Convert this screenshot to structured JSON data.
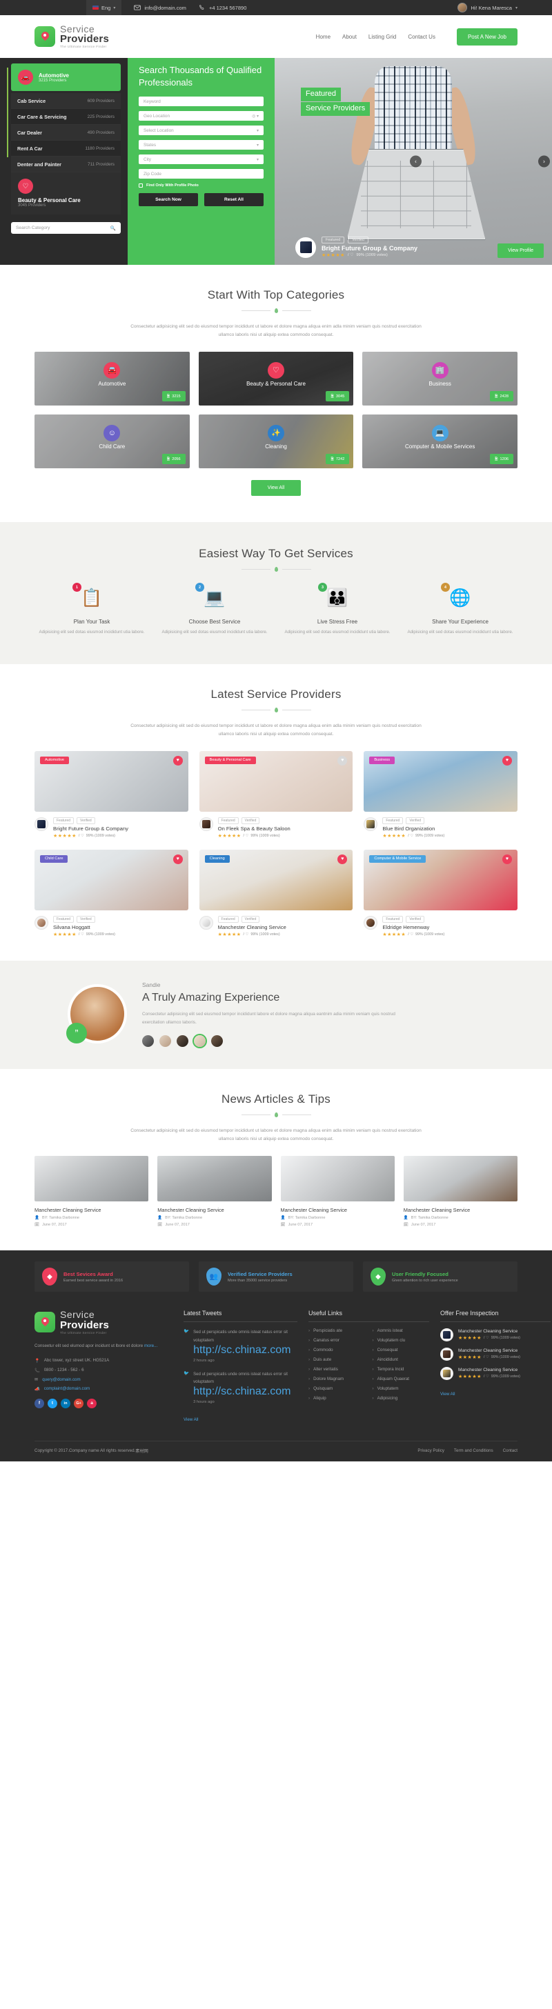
{
  "topbar": {
    "lang": "Eng",
    "email": "info@domain.com",
    "phone": "+4 1234 567890",
    "user_greeting": "Hi! Kena Maresca"
  },
  "header": {
    "logo_line1": "Service",
    "logo_line2": "Providers",
    "logo_tagline": "The Ultimate Service Finder",
    "nav": [
      "Home",
      "About",
      "Listing Grid",
      "Contact Us"
    ],
    "cta": "Post A New Job"
  },
  "hero": {
    "search_title": "Search Thousands of Qualified Professionals",
    "fields": [
      {
        "placeholder": "Keyword",
        "icon": ""
      },
      {
        "placeholder": "Geo Location",
        "icon": "target"
      },
      {
        "placeholder": "Select Location",
        "icon": "caret"
      },
      {
        "placeholder": "States",
        "icon": "caret"
      },
      {
        "placeholder": "City",
        "icon": "caret"
      },
      {
        "placeholder": "Zip Code",
        "icon": ""
      }
    ],
    "checkbox_label": "Find Only With Profile Photo",
    "search_button": "Search Now",
    "reset_button": "Reset All",
    "featured_line1": "Featured",
    "featured_line2": "Service Providers",
    "slide": {
      "badges": [
        "Featured",
        "Verified"
      ],
      "title": "Bright Future Group & Company",
      "rating_text": "99% (1009 votes)",
      "stars": "★★★★★",
      "button": "View Profile"
    },
    "categories_panel": {
      "active": {
        "name": "Automotive",
        "count": "3215 Providers",
        "icon": "car-icon"
      },
      "items": [
        {
          "name": "Cab Service",
          "count": "609 Providers"
        },
        {
          "name": "Car Care & Servicing",
          "count": "225 Providers"
        },
        {
          "name": "Car Dealer",
          "count": "490 Providers"
        },
        {
          "name": "Rent A Car",
          "count": "1180 Providers"
        },
        {
          "name": "Denter and Painter",
          "count": "711 Providers"
        }
      ],
      "next": {
        "name": "Beauty & Personal Care",
        "count": "3045 Providers",
        "icon": "heart-icon"
      },
      "search_placeholder": "Search Category"
    }
  },
  "categories_section": {
    "title": "Start With Top Categories",
    "subtitle": "Consectetur adipisicing elit sed do eiusmod tempor incididunt ut labore et dolore magna aliqua enim adla minim veniam quis nostrud exercitation ullamco laboris nisi ut aliquip extea commodo consequat.",
    "cards": [
      {
        "name": "Automotive",
        "count": "3215",
        "color": "#ef3e5c",
        "icon": "car-icon"
      },
      {
        "name": "Beauty & Personal Care",
        "count": "3045",
        "color": "#ef3e5c",
        "icon": "heart-icon"
      },
      {
        "name": "Business",
        "count": "2428",
        "color": "#cf46b8",
        "icon": "building-icon"
      },
      {
        "name": "Child Care",
        "count": "2056",
        "color": "#6c63c7",
        "icon": "smiley-icon"
      },
      {
        "name": "Cleaning",
        "count": "7242",
        "color": "#2f7fc9",
        "icon": "wand-icon"
      },
      {
        "name": "Computer & Mobile Services",
        "count": "1206",
        "color": "#4aa3df",
        "icon": "laptop-icon"
      }
    ],
    "view_all": "View All"
  },
  "steps_section": {
    "title": "Easiest Way To Get Services",
    "steps": [
      {
        "num": "1",
        "num_color": "#e2294f",
        "title": "Plan Your Task",
        "desc": "Adipisicing elit sed dotas eiusmod incididunt utia labore.",
        "glyph": "📋"
      },
      {
        "num": "2",
        "num_color": "#3d9ad8",
        "title": "Choose Best Service",
        "desc": "Adipisicing elit sed dotas eiusmod incididunt utia labore.",
        "glyph": "💻"
      },
      {
        "num": "3",
        "num_color": "#43b55c",
        "title": "Live Stress Free",
        "desc": "Adipisicing elit sed dotas eiusmod incididunt utia labore.",
        "glyph": "👪"
      },
      {
        "num": "4",
        "num_color": "#cd9539",
        "title": "Share Your Experience",
        "desc": "Adipisicing elit sed dotas eiusmod incididunt utia labore.",
        "glyph": "🌐"
      }
    ]
  },
  "providers_section": {
    "title": "Latest Service Providers",
    "subtitle": "Consectetur adipisicing elit sed do eiusmod tempor incididunt ut labore et dolore magna aliqua enim adla minim veniam quis nostrud exercitation ullamco laboris nisi ut aliquip extea commodo consequat.",
    "badges": [
      "Featured",
      "Verified"
    ],
    "stars": "★★★★★",
    "rating_text": "99% (1009 votes)",
    "cards": [
      {
        "tag": "Automotive",
        "tag_color": "#ef3e5c",
        "heart_color": "#ef3e5c",
        "name": "Bright Future Group & Company"
      },
      {
        "tag": "Beauty & Personal Care",
        "tag_color": "#ef3e5c",
        "heart_color": "#cfcfcf",
        "name": "On Fleek Spa & Beauty Saloon"
      },
      {
        "tag": "Business",
        "tag_color": "#cf46b8",
        "heart_color": "#ef3e5c",
        "name": "Blue Bird Organization"
      },
      {
        "tag": "Child Care",
        "tag_color": "#6c63c7",
        "heart_color": "#ef3e5c",
        "name": "Silvana Hoggatt"
      },
      {
        "tag": "Cleaning",
        "tag_color": "#2f7fc9",
        "heart_color": "#ef3e5c",
        "name": "Manchester Cleaning Service"
      },
      {
        "tag": "Computer & Mobile Service",
        "tag_color": "#4aa3df",
        "heart_color": "#ef3e5c",
        "name": "Eldridge Hemenway"
      }
    ]
  },
  "testimonial": {
    "name": "Sandie",
    "heading": "A Truly Amazing Experience",
    "text": "Consectetur adipisicing elit sed eiusmod tempor incididunt labore et dolore magna aliqua eantnim adia minim veniam quis nostrud exercitation ullamco laboris.",
    "quote_glyph": "”"
  },
  "news_section": {
    "title": "News Articles & Tips",
    "subtitle": "Consectetur adipisicing elit sed do eiusmod tempor incididunt ut labore et dolore magna aliqua enim adla minim veniam quis nostrud exercitation ullamco laboris nisi ut aliquip extea commodo consequat.",
    "cards": [
      {
        "title": "Manchester Cleaning Service",
        "by": "BY: Tamika Darbonne",
        "date": "June 07, 2017"
      },
      {
        "title": "Manchester Cleaning Service",
        "by": "BY: Tamika Darbonne",
        "date": "June 07, 2017"
      },
      {
        "title": "Manchester Cleaning Service",
        "by": "BY: Tamika Darbonne",
        "date": "June 07, 2017"
      },
      {
        "title": "Manchester Cleaning Service",
        "by": "BY: Tamika Darbonne",
        "date": "June 07, 2017"
      }
    ]
  },
  "footer": {
    "awards": [
      {
        "title": "Best Sevices Award",
        "desc": "Earned best service award in 2016",
        "color": "#ef3e5c",
        "icon": "diamond-icon"
      },
      {
        "title": "Verified Service Providers",
        "desc": "More than 35000 service providers",
        "color": "#4aa3df",
        "icon": "users-icon"
      },
      {
        "title": "User Friendly Focused",
        "desc": "Given attention to rich user experience",
        "color": "#4ac159",
        "icon": "diamond-icon"
      }
    ],
    "about": {
      "logo_line1": "Service",
      "logo_line2": "Providers",
      "logo_tagline": "The Ultimate Service Finder",
      "text": "Conseetur elit sed elumod apor incidunt ut lbore et dolore",
      "more": "more...",
      "address": "Abc tower, xyz street UK. HG521A",
      "phone": "0800 - 1234 - 562 - 6",
      "email": "query@domain.com",
      "complaint": "complaint@domain.com",
      "socials": [
        {
          "name": "facebook-icon",
          "glyph": "f",
          "color": "#3b5998"
        },
        {
          "name": "twitter-icon",
          "glyph": "t",
          "color": "#1da1f2"
        },
        {
          "name": "linkedin-icon",
          "glyph": "in",
          "color": "#0077b5"
        },
        {
          "name": "google-plus-icon",
          "glyph": "G+",
          "color": "#db4437"
        },
        {
          "name": "rss-icon",
          "glyph": "a",
          "color": "#e2294f"
        }
      ]
    },
    "tweets": {
      "heading": "Latest Tweets",
      "items": [
        {
          "text": "Sed ut perspicatis unde omnis isteat natus error sit voluptatem",
          "link": "http://sc.chinaz.com",
          "ago": "2 hours ago"
        },
        {
          "text": "Sed ut perspicatis unde omnis isteat natus error sit voluptatem",
          "link": "http://sc.chinaz.com",
          "ago": "3 hours ago"
        }
      ],
      "view_all": "View All"
    },
    "useful_links": {
      "heading": "Useful Links",
      "items": [
        "Perspiciatis ate",
        "Aomnis isteat",
        "Canatus error",
        "Voluptatem clu",
        "Commodo",
        "Consequat",
        "Duis aute",
        "Aincididunt",
        "Alter veritatis",
        "Tempora Incid",
        "Dolore Magnam",
        "Aliquam Quaerat",
        "Quisquam",
        "Voluptatem",
        "Aliquip",
        "Adipisicing"
      ]
    },
    "offers": {
      "heading": "Offer Free Inspection",
      "items": [
        {
          "name": "Manchester Cleaning Service",
          "stars": "★★★★★",
          "rating": "99% (1009 votes)"
        },
        {
          "name": "Manchester Cleaning Service",
          "stars": "★★★★★",
          "rating": "99% (1009 votes)"
        },
        {
          "name": "Manchester Cleaning Service",
          "stars": "★★★★★",
          "rating": "99% (1009 votes)"
        }
      ],
      "view_all": "View All"
    },
    "copyright": "Copyright © 2017.Company name All rights reserved.",
    "copyright_link": "素材网",
    "bottom_links": [
      "Privacy Policy",
      "Term and Conditions",
      "Contact"
    ]
  }
}
